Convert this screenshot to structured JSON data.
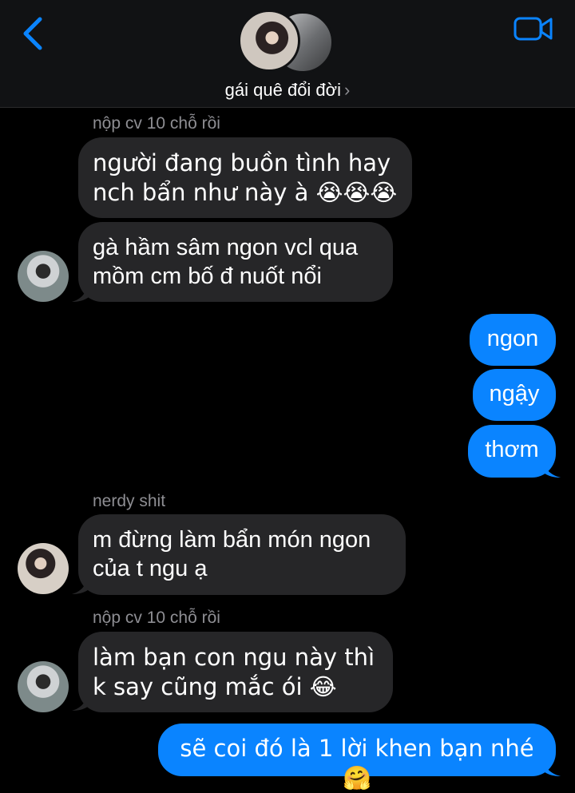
{
  "header": {
    "title": "gái quê đổi đời",
    "back_icon": "chevron-left-icon",
    "video_icon": "video-camera-icon"
  },
  "messages": [
    {
      "type": "label",
      "text": "nộp cv 10 chỗ rồi"
    },
    {
      "type": "in",
      "text": "người đang buồn tình hay nch bẩn như này à 😭😭😭"
    },
    {
      "type": "in",
      "text": "gà hầm sâm ngon vcl qua mồm cm bố đ nuốt nổi"
    },
    {
      "type": "out",
      "text": "ngon"
    },
    {
      "type": "out",
      "text": "ngậy"
    },
    {
      "type": "out",
      "text": "thơm"
    },
    {
      "type": "label",
      "text": "nerdy shit"
    },
    {
      "type": "in",
      "text": "m đừng làm bẩn món ngon của t ngu ạ"
    },
    {
      "type": "label",
      "text": "nộp cv 10 chỗ rồi"
    },
    {
      "type": "in",
      "text": "làm bạn con ngu này thì k say cũng mắc ói 😂"
    },
    {
      "type": "out",
      "text": "sẽ coi đó là 1 lời khen bạn nhé 🤗"
    }
  ],
  "colors": {
    "incoming_bubble": "#262628",
    "outgoing_bubble": "#0a84ff",
    "accent": "#0a84ff"
  }
}
